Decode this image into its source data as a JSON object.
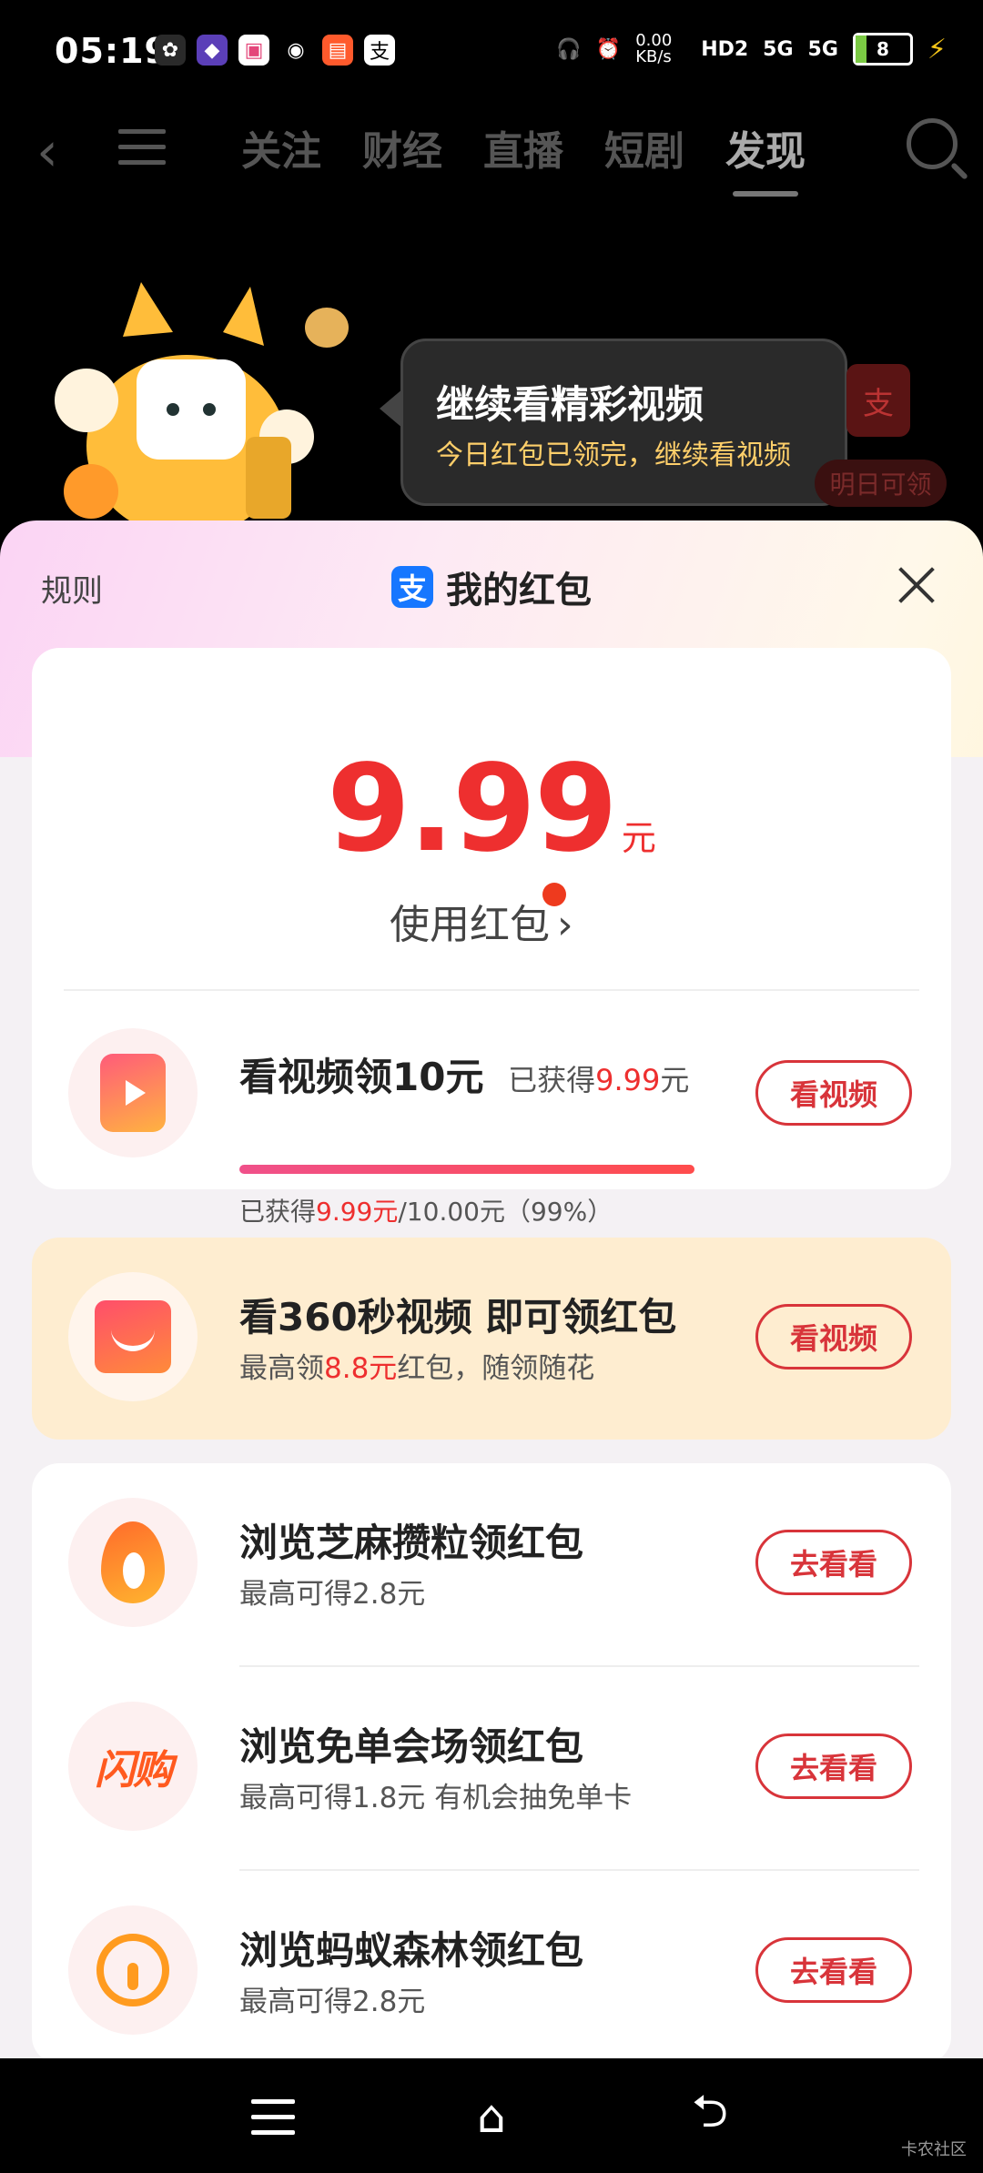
{
  "status_bar": {
    "time": "05:19",
    "app_icons": [
      "wechat-icon",
      "game-icon",
      "bilibili-icon",
      "signal-icon",
      "shop-icon",
      "alipay-icon"
    ],
    "net_speed": "0.00 KB/s",
    "hd_label": "HD2",
    "network_1": "5G",
    "network_2": "5G",
    "battery": "8"
  },
  "top_nav": {
    "tabs": [
      "关注",
      "财经",
      "直播",
      "短剧",
      "发现"
    ],
    "active_tab": "发现"
  },
  "tooltip": {
    "title": "继续看精彩视频",
    "subtitle": "今日红包已领完，继续看视频"
  },
  "side_badge": {
    "icon": "支",
    "label": "明日可领"
  },
  "sheet": {
    "rules_label": "规则",
    "logo": "支",
    "title": "我的红包",
    "amount": "9.99",
    "amount_unit": "元",
    "use_link": "使用红包",
    "video_task": {
      "title": "看视频领10元",
      "earned_prefix": "已获得",
      "earned_value": "9.99",
      "earned_suffix": "元",
      "progress_prefix": "已获得",
      "progress_value": "9.99元",
      "progress_rest": "/10.00元（99%）",
      "progress_fraction": 0.99,
      "button": "看视频"
    },
    "promo_task": {
      "title": "看360秒视频 即可领红包",
      "sub_prefix": "最高领",
      "sub_value": "8.8元",
      "sub_suffix": "红包，随领随花",
      "button": "看视频"
    },
    "browse_tasks": [
      {
        "title": "浏览芝麻攒粒领红包",
        "sub": "最高可得2.8元",
        "button": "去看看"
      },
      {
        "title": "浏览免单会场领红包",
        "sub": "最高可得1.8元 有机会抽免单卡",
        "logo_text": "闪购",
        "button": "去看看"
      },
      {
        "title": "浏览蚂蚁森林领红包",
        "sub": "最高可得2.8元",
        "button": "去看看"
      }
    ]
  },
  "bottom_nav": {
    "home_icon": "⌂",
    "back_icon": "⮌"
  },
  "watermark": "卡农社区"
}
